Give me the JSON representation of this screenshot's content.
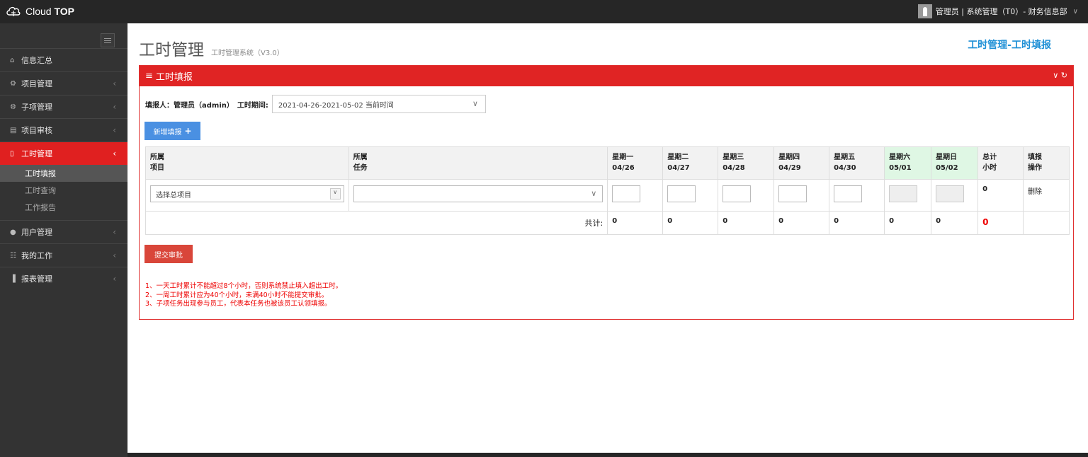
{
  "brand": {
    "name": "Cloud",
    "name_bold": "TOP"
  },
  "user": {
    "info": "管理员 | 系统管理（T0）- 财务信息部",
    "dropdown_icon": "chevron-down-icon"
  },
  "sidebar": {
    "items": [
      {
        "label": "信息汇总",
        "icon": "home-icon"
      },
      {
        "label": "项目管理",
        "icon": "cogs-icon"
      },
      {
        "label": "子项管理",
        "icon": "cogs-icon"
      },
      {
        "label": "项目审核",
        "icon": "document-icon"
      },
      {
        "label": "工时管理",
        "icon": "bookmark-icon",
        "active": true
      },
      {
        "label": "用户管理",
        "icon": "user-icon"
      },
      {
        "label": "我的工作",
        "icon": "sitemap-icon"
      },
      {
        "label": "报表管理",
        "icon": "bar-chart-icon"
      }
    ],
    "subitems": [
      "工时填报",
      "工时查询",
      "工作报告"
    ]
  },
  "page": {
    "title": "工时管理",
    "subtitle": "工时管理系统（V3.0）",
    "breadcrumb": "工时管理-工时填报"
  },
  "panel": {
    "title": "工时填报"
  },
  "form": {
    "reporter_label": "填报人：管理员（admin）",
    "period_label": "工时期间:",
    "period_value": "2021-04-26-2021-05-02 当前时间"
  },
  "buttons": {
    "add": "新增填报",
    "submit": "提交审批"
  },
  "table": {
    "headers": [
      {
        "l1": "所属",
        "l2": "项目"
      },
      {
        "l1": "所属",
        "l2": "任务"
      },
      {
        "l1": "星期一",
        "l2": "04/26"
      },
      {
        "l1": "星期二",
        "l2": "04/27"
      },
      {
        "l1": "星期三",
        "l2": "04/28"
      },
      {
        "l1": "星期四",
        "l2": "04/29"
      },
      {
        "l1": "星期五",
        "l2": "04/30"
      },
      {
        "l1": "星期六",
        "l2": "05/01"
      },
      {
        "l1": "星期日",
        "l2": "05/02"
      },
      {
        "l1": "总计",
        "l2": "小时"
      },
      {
        "l1": "填报",
        "l2": "操作"
      }
    ],
    "row": {
      "project_placeholder": "选择总项目",
      "total": "0",
      "delete": "删除"
    },
    "totals": {
      "label": "共计:",
      "values": [
        "0",
        "0",
        "0",
        "0",
        "0",
        "0",
        "0"
      ],
      "sum": "0"
    }
  },
  "notes": [
    "1、一天工时累计不能超过8个小时，否则系统禁止填入超出工时。",
    "2、一周工时累计应为40个小时，未满40小时不能提交审批。",
    "3、子项任务出现参与员工，代表本任务也被该员工认领填报。"
  ],
  "colors": {
    "accent": "#e02424",
    "primary": "#4a90e2",
    "crumb": "#1e90d6",
    "weekend": "#dff7e4"
  }
}
